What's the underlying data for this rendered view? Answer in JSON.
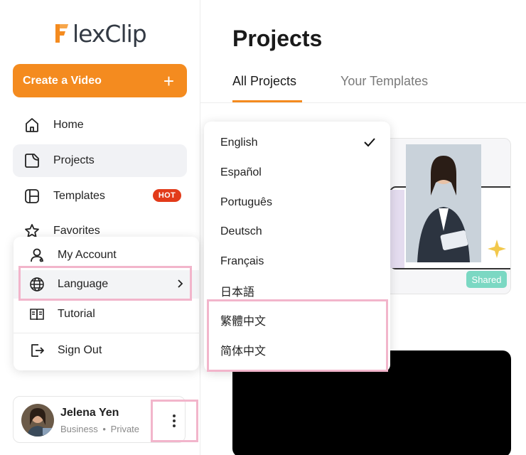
{
  "brand": {
    "name": "lexClip",
    "accent": "#f48b1f"
  },
  "sidebar": {
    "create_label": "Create a Video",
    "create_plus": "+",
    "nav": [
      {
        "label": "Home",
        "icon": "home-icon"
      },
      {
        "label": "Projects",
        "icon": "projects-icon",
        "active": true
      },
      {
        "label": "Templates",
        "icon": "templates-icon",
        "badge": "HOT"
      },
      {
        "label": "Favorites",
        "icon": "star-icon"
      }
    ]
  },
  "account_menu": {
    "items": [
      {
        "label": "My Account",
        "icon": "user-icon"
      },
      {
        "label": "Language",
        "icon": "globe-icon",
        "submenu": true
      },
      {
        "label": "Tutorial",
        "icon": "book-icon"
      },
      {
        "label": "Sign Out",
        "icon": "sign-out-icon"
      }
    ]
  },
  "user": {
    "name": "Jelena Yen",
    "plan": "Business",
    "separator": "•",
    "visibility": "Private"
  },
  "main": {
    "title": "Projects",
    "tabs": [
      {
        "label": "All Projects",
        "active": true
      },
      {
        "label": "Your Templates",
        "active": false
      }
    ],
    "card_badge": "Shared"
  },
  "language_menu": {
    "selected": "English",
    "options": [
      "English",
      "Español",
      "Português",
      "Deutsch",
      "Français",
      "日本語",
      "繁體中文",
      "简体中文"
    ]
  }
}
